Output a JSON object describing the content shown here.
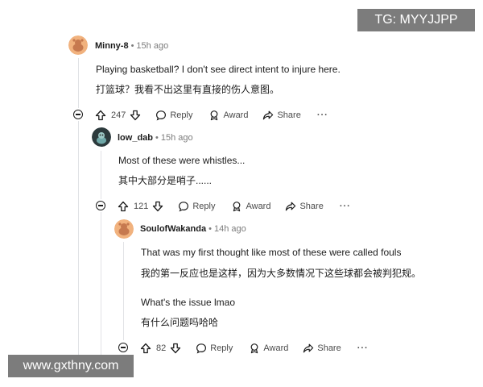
{
  "watermarks": {
    "top_right": "TG: MYYJJPP",
    "bottom_left": "www.gxthny.com"
  },
  "comments": [
    {
      "username": "Minny-8",
      "separator": "•",
      "time": "15h ago",
      "lines": [
        "Playing basketball? I don't see direct intent to injure here.",
        "打篮球？我看不出这里有直接的伤人意图。"
      ],
      "votes": "247",
      "reply": "Reply",
      "award": "Award",
      "share": "Share",
      "more": "···",
      "avatar": "avatar-snoo-icon"
    },
    {
      "username": "low_dab",
      "separator": "•",
      "time": "15h ago",
      "lines": [
        "Most of these were whistles...",
        "其中大部分是哨子......"
      ],
      "votes": "121",
      "reply": "Reply",
      "award": "Award",
      "share": "Share",
      "more": "···",
      "avatar": "avatar-dark-icon"
    },
    {
      "username": "SoulofWakanda",
      "separator": "•",
      "time": "14h ago",
      "lines": [
        "That was my first thought like most of these were called fouls",
        "我的第一反应也是这样，因为大多数情况下这些球都会被判犯规。",
        "What's the issue lmao",
        "有什么问题吗哈哈"
      ],
      "votes": "82",
      "reply": "Reply",
      "award": "Award",
      "share": "Share",
      "more": "···",
      "avatar": "avatar-snoo-icon"
    }
  ],
  "colors": {
    "text": "#1c1c1c",
    "muted": "#7c7c7c",
    "action": "#4a4a4a",
    "avatar_peach": "#f1b27e",
    "thread_line": "#e1e3e6",
    "watermark_bg": "#7c7c7c"
  }
}
